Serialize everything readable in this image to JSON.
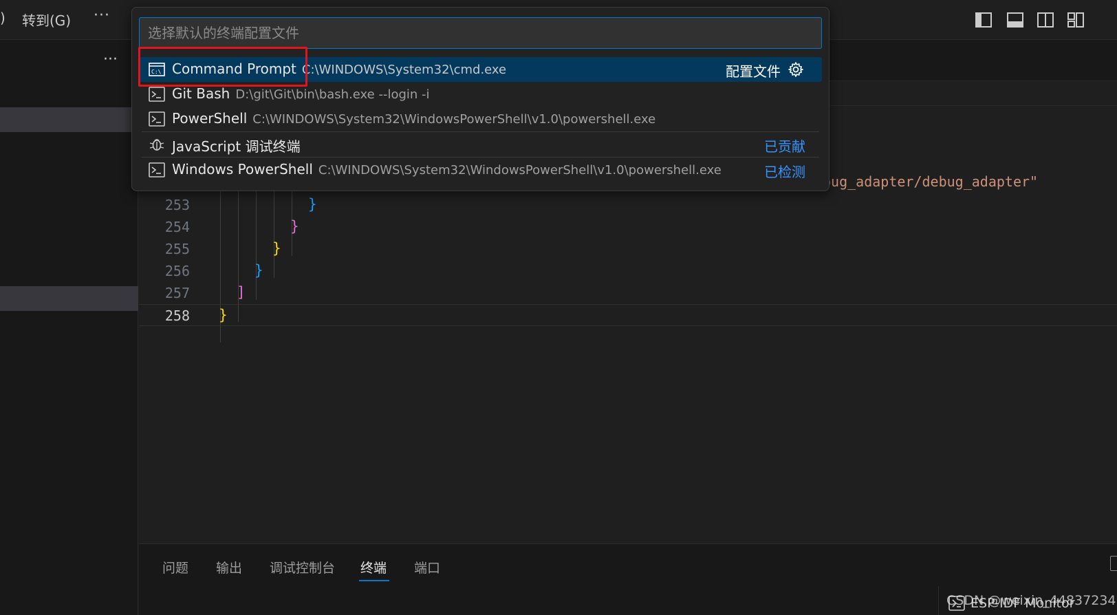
{
  "menu": {
    "paren": ")",
    "goto": "转到(G)",
    "more": "···"
  },
  "sidebar": {
    "more": "···"
  },
  "editor": {
    "lines": [
      {
        "number": "253",
        "brace": "}"
      },
      {
        "number": "254",
        "brace": "}"
      },
      {
        "number": "255",
        "brace": "}"
      },
      {
        "number": "256",
        "brace": "}"
      },
      {
        "number": "257",
        "brace": "]"
      },
      {
        "number": "258",
        "brace": "}"
      }
    ],
    "string_fragment": "oug_adapter/debug_adapter\""
  },
  "quickpick": {
    "placeholder": "选择默认的终端配置文件",
    "items": [
      {
        "label": "Command Prompt",
        "description": "C:\\WINDOWS\\System32\\cmd.exe",
        "right": "配置文件",
        "icon": "cmd-icon"
      },
      {
        "label": "Git Bash",
        "description": "D:\\git\\Git\\bin\\bash.exe --login -i",
        "right": "",
        "icon": "terminal-icon"
      },
      {
        "label": "PowerShell",
        "description": "C:\\WINDOWS\\System32\\WindowsPowerShell\\v1.0\\powershell.exe",
        "right": "",
        "icon": "terminal-icon"
      },
      {
        "label": "JavaScript 调试终端",
        "description": "",
        "right": "已贡献",
        "icon": "debug-icon"
      },
      {
        "label": "Windows PowerShell",
        "description": "C:\\WINDOWS\\System32\\WindowsPowerShell\\v1.0\\powershell.exe",
        "right": "已检测",
        "icon": "terminal-icon"
      }
    ]
  },
  "panel": {
    "tabs": [
      "问题",
      "输出",
      "调试控制台",
      "终端",
      "端口"
    ],
    "active_tab": "终端",
    "terminal_item": "ESP-IDF Monitor"
  },
  "watermark": "CSDN @weixin_44837234",
  "colors": {
    "accent": "#0078d4",
    "selection": "#04395e",
    "highlight_box": "#e0161e",
    "link": "#3794ff",
    "brace_yellow": "#ffd700",
    "brace_pink": "#da70d6",
    "brace_blue": "#179fff"
  }
}
